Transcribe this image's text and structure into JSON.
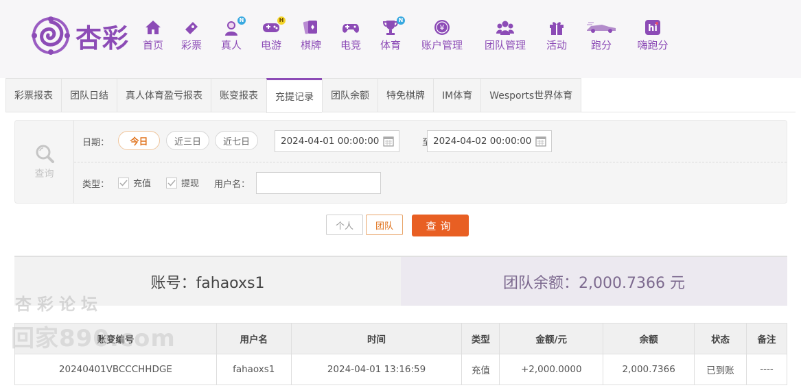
{
  "logo": {
    "text": "杏彩"
  },
  "nav": [
    {
      "label": "首页",
      "icon": "home-icon",
      "badge": ""
    },
    {
      "label": "彩票",
      "icon": "ticket-icon",
      "badge": ""
    },
    {
      "label": "真人",
      "icon": "live-dealer-icon",
      "badge": "N"
    },
    {
      "label": "电游",
      "icon": "gamepad-icon",
      "badge": "H"
    },
    {
      "label": "棋牌",
      "icon": "cards-icon",
      "badge": ""
    },
    {
      "label": "电竞",
      "icon": "esports-controller-icon",
      "badge": ""
    },
    {
      "label": "体育",
      "icon": "trophy-icon",
      "badge": "N"
    },
    {
      "label": "账户管理",
      "icon": "yen-coin-icon",
      "badge": ""
    },
    {
      "label": "团队管理",
      "icon": "team-icon",
      "badge": ""
    },
    {
      "label": "活动",
      "icon": "gift-icon",
      "badge": ""
    },
    {
      "label": "跑分",
      "icon": "race-car-icon",
      "badge": ""
    },
    {
      "label": "嗨跑分",
      "icon": "hi-icon",
      "badge": ""
    }
  ],
  "tabs": [
    {
      "label": "彩票报表",
      "active": false
    },
    {
      "label": "团队日结",
      "active": false
    },
    {
      "label": "真人体育盈亏报表",
      "active": false
    },
    {
      "label": "账变报表",
      "active": false
    },
    {
      "label": "充提记录",
      "active": true
    },
    {
      "label": "团队余额",
      "active": false
    },
    {
      "label": "特免棋牌",
      "active": false
    },
    {
      "label": "IM体育",
      "active": false
    },
    {
      "label": "Wesports世界体育",
      "active": false
    }
  ],
  "filter": {
    "side_label": "查询",
    "date_label": "日期：",
    "quick_dates": [
      "今日",
      "近三日",
      "近七日"
    ],
    "start_date": "2024-04-01 00:00:00",
    "to_label": "至",
    "end_date": "2024-04-02 00:00:00",
    "type_label": "类型：",
    "type_options": [
      "充值",
      "提现"
    ],
    "username_label": "用户名：",
    "username_value": ""
  },
  "actions": {
    "personal": "个人",
    "team": "团队",
    "query": "查询"
  },
  "summary": {
    "account": "账号：fahaoxs1",
    "team_balance": "团队余额：2,000.7366 元"
  },
  "table": {
    "headers": [
      "账变编号",
      "用户名",
      "时间",
      "类型",
      "金额/元",
      "余额",
      "状态",
      "备注"
    ],
    "rows": [
      [
        "20240401VBCCCHHDGE",
        "fahaoxs1",
        "2024-04-01 13:16:59",
        "充值",
        "+2,000.0000",
        "2,000.7366",
        "已到账",
        "----"
      ]
    ]
  },
  "watermark": {
    "line1": "杏彩论坛",
    "line2": "回家890.com"
  },
  "colors": {
    "brand": "#8c4bb6",
    "accent": "#e85f23",
    "success": "#4a9d1e"
  }
}
